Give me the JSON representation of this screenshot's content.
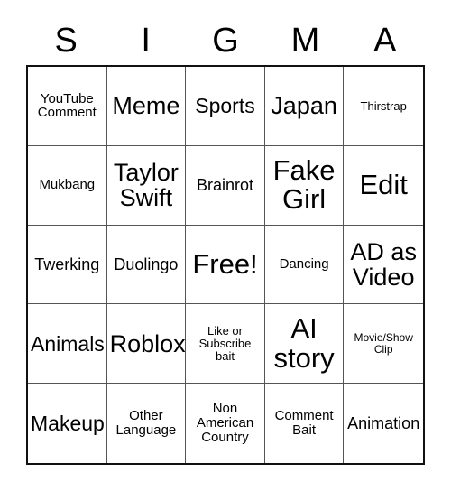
{
  "card": {
    "title_letters": [
      "S",
      "I",
      "G",
      "M",
      "A"
    ],
    "columns": 5,
    "rows": 5,
    "colors": {
      "background": "#ffffff",
      "text": "#000000",
      "outer_border": "#111111",
      "inner_border": "#555555"
    },
    "cells": [
      {
        "text": "YouTube\nComment",
        "size": "sm"
      },
      {
        "text": "Meme",
        "size": "xl"
      },
      {
        "text": "Sports",
        "size": "lg"
      },
      {
        "text": "Japan",
        "size": "xl"
      },
      {
        "text": "Thirstrap",
        "size": "xs"
      },
      {
        "text": "Mukbang",
        "size": "sm"
      },
      {
        "text": "Taylor\nSwift",
        "size": "xl"
      },
      {
        "text": "Brainrot",
        "size": "md"
      },
      {
        "text": "Fake\nGirl",
        "size": "xxl"
      },
      {
        "text": "Edit",
        "size": "xxl"
      },
      {
        "text": "Twerking",
        "size": "md"
      },
      {
        "text": "Duolingo",
        "size": "md"
      },
      {
        "text": "Free!",
        "size": "xxl"
      },
      {
        "text": "Dancing",
        "size": "sm"
      },
      {
        "text": "AD as\nVideo",
        "size": "xl"
      },
      {
        "text": "Animals",
        "size": "lg"
      },
      {
        "text": "Roblox",
        "size": "xl"
      },
      {
        "text": "Like or\nSubscribe\nbait",
        "size": "xs"
      },
      {
        "text": "AI\nstory",
        "size": "xxl"
      },
      {
        "text": "Movie/Show\nClip",
        "size": "xxs"
      },
      {
        "text": "Makeup",
        "size": "lg"
      },
      {
        "text": "Other\nLanguage",
        "size": "sm"
      },
      {
        "text": "Non\nAmerican\nCountry",
        "size": "sm"
      },
      {
        "text": "Comment\nBait",
        "size": "sm"
      },
      {
        "text": "Animation",
        "size": "md"
      }
    ]
  }
}
